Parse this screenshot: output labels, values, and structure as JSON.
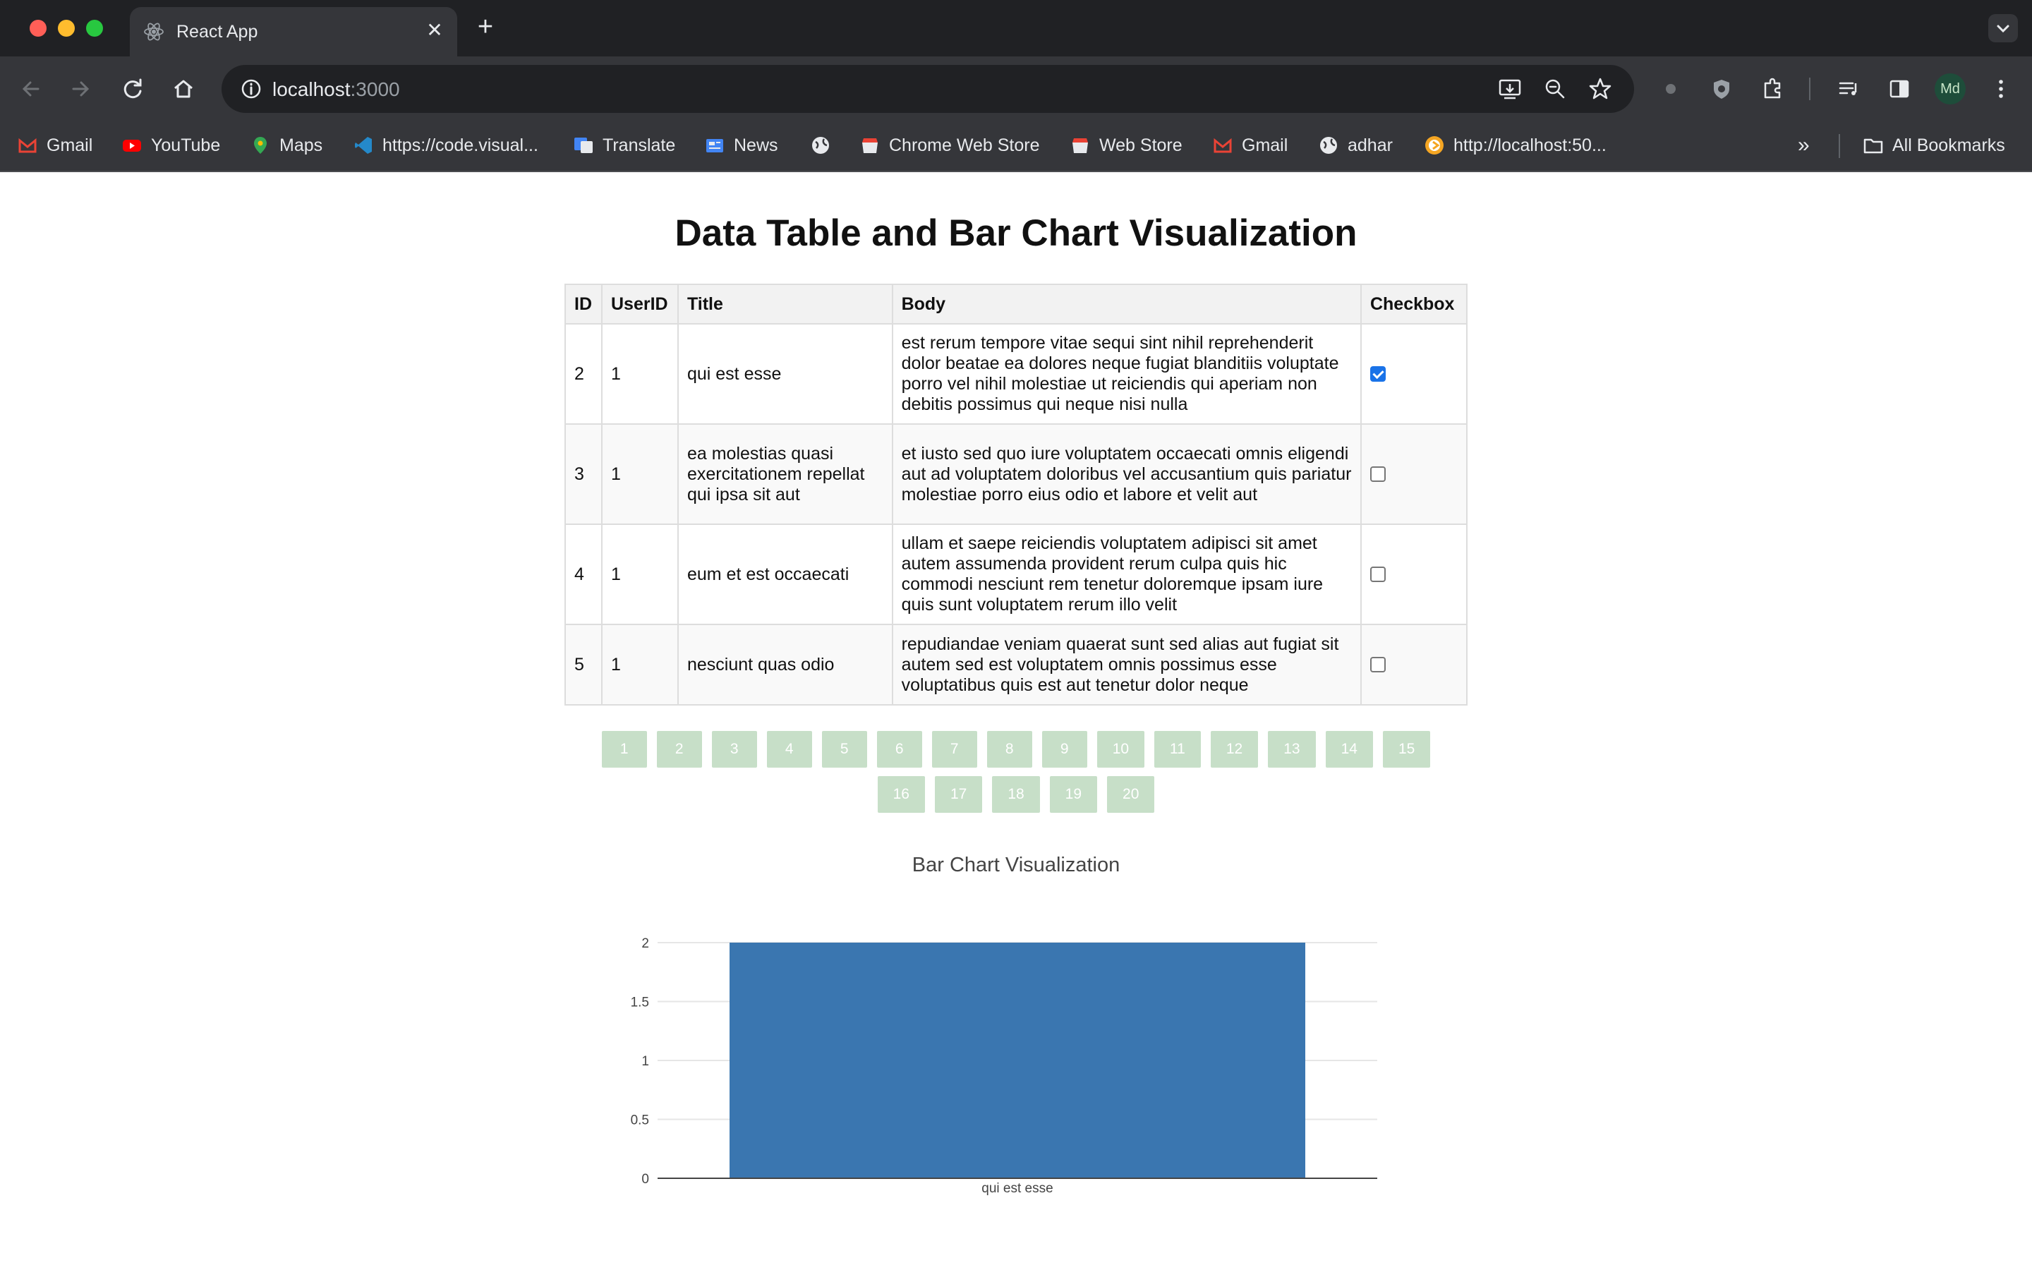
{
  "browser": {
    "tab_title": "React App",
    "tab_close": "✕",
    "new_tab": "+",
    "url_host": "localhost",
    "url_port": ":3000",
    "avatar_initials": "Md",
    "bookmarks": [
      {
        "label": "Gmail",
        "icon": "gmail-icon"
      },
      {
        "label": "YouTube",
        "icon": "youtube-icon"
      },
      {
        "label": "Maps",
        "icon": "maps-icon"
      },
      {
        "label": "https://code.visual...",
        "icon": "vscode-icon"
      },
      {
        "label": "Translate",
        "icon": "translate-icon"
      },
      {
        "label": "News",
        "icon": "news-icon"
      },
      {
        "label": "",
        "icon": "globe-icon"
      },
      {
        "label": "Chrome Web Store",
        "icon": "webstore-icon"
      },
      {
        "label": "Web Store",
        "icon": "webstore-icon"
      },
      {
        "label": "Gmail",
        "icon": "gmail-icon"
      },
      {
        "label": "adhar",
        "icon": "globe-icon"
      },
      {
        "label": "http://localhost:50...",
        "icon": "localhost-icon"
      }
    ],
    "all_bookmarks": "All Bookmarks",
    "overflow": "»"
  },
  "page": {
    "title": "Data Table and Bar Chart Visualization",
    "table": {
      "headers": [
        "ID",
        "UserID",
        "Title",
        "Body",
        "Checkbox"
      ],
      "rows": [
        {
          "id": "2",
          "user_id": "1",
          "title": "qui est esse",
          "body": "est rerum tempore vitae sequi sint nihil reprehenderit dolor beatae ea dolores neque fugiat blanditiis voluptate porro vel nihil molestiae ut reiciendis qui aperiam non debitis possimus qui neque nisi nulla",
          "checked": true
        },
        {
          "id": "3",
          "user_id": "1",
          "title": "ea molestias quasi exercitationem repellat qui ipsa sit aut",
          "body": "et iusto sed quo iure voluptatem occaecati omnis eligendi aut ad voluptatem doloribus vel accusantium quis pariatur molestiae porro eius odio et labore et velit aut",
          "checked": false
        },
        {
          "id": "4",
          "user_id": "1",
          "title": "eum et est occaecati",
          "body": "ullam et saepe reiciendis voluptatem adipisci sit amet autem assumenda provident rerum culpa quis hic commodi nesciunt rem tenetur doloremque ipsam iure quis sunt voluptatem rerum illo velit",
          "checked": false
        },
        {
          "id": "5",
          "user_id": "1",
          "title": "nesciunt quas odio",
          "body": "repudiandae veniam quaerat sunt sed alias aut fugiat sit autem sed est voluptatem omnis possimus esse voluptatibus quis est aut tenetur dolor neque",
          "checked": false
        }
      ]
    },
    "pagination": {
      "row1": [
        "1",
        "2",
        "3",
        "4",
        "5",
        "6",
        "7",
        "8",
        "9",
        "10",
        "11",
        "12",
        "13",
        "14",
        "15"
      ],
      "row2": [
        "16",
        "17",
        "18",
        "19",
        "20"
      ]
    },
    "chart_title": "Bar Chart Visualization"
  },
  "chart_data": {
    "type": "bar",
    "title": "Bar Chart Visualization",
    "categories": [
      "qui est esse"
    ],
    "values": [
      2
    ],
    "ylim": [
      0,
      2
    ],
    "yticks": [
      "0",
      "0.5",
      "1",
      "1.5",
      "2"
    ],
    "bar_color": "#3a76b0",
    "grid": true
  }
}
